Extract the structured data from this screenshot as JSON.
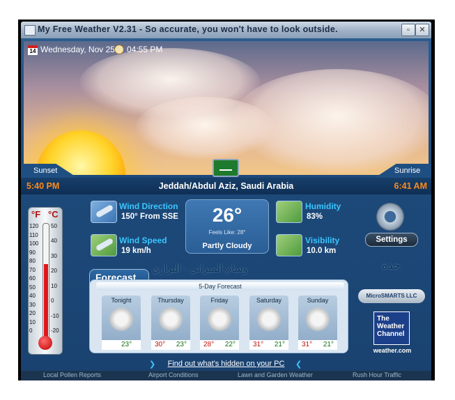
{
  "window": {
    "title": "My Free Weather V2.31 -  So accurate, you won't have to look outside.",
    "close_label": "✕"
  },
  "header": {
    "date": "Wednesday, Nov 25",
    "time": "04:55 PM",
    "calendar_day": "14"
  },
  "sun": {
    "sunset_label": "Sunset",
    "sunrise_label": "Sunrise",
    "sunset_time": "5:40 PM",
    "sunrise_time": "6:41 AM"
  },
  "location": "Jeddah/Abdul Aziz, Saudi Arabia",
  "thermometer": {
    "f_label": "°F",
    "c_label": "°C",
    "f_ticks": [
      "120",
      "110",
      "100",
      "90",
      "80",
      "70",
      "60",
      "50",
      "40",
      "30",
      "20",
      "10",
      "0"
    ],
    "c_ticks": [
      "50",
      "40",
      "30",
      "20",
      "10",
      "0",
      "-10",
      "-20"
    ]
  },
  "conditions": {
    "wind_direction_label": "Wind Direction",
    "wind_direction_value": "150° From SSE",
    "wind_speed_label": "Wind Speed",
    "wind_speed_value": "19 km/h",
    "humidity_label": "Humidity",
    "humidity_value": "83%",
    "visibility_label": "Visibility",
    "visibility_value": "10.0 km",
    "temperature": "26°",
    "feels_like": "Feels Like: 28°",
    "description": "Partly Cloudy"
  },
  "settings_label": "Settings",
  "arabic_text": "وسام الميزاني - البراري",
  "arabic_city": "جدة",
  "forecast": {
    "tab_label": "Forecast",
    "header": "5-Day Forecast",
    "days": [
      {
        "name": "Tonight",
        "hi": "",
        "lo": "23°"
      },
      {
        "name": "Thursday",
        "hi": "30°",
        "lo": "23°"
      },
      {
        "name": "Friday",
        "hi": "28°",
        "lo": "22°"
      },
      {
        "name": "Saturday",
        "hi": "31°",
        "lo": "21°"
      },
      {
        "name": "Sunday",
        "hi": "31°",
        "lo": "21°"
      }
    ]
  },
  "branding": {
    "microsmarts": "MicroSMARTS LLC",
    "twc_line1": "The",
    "twc_line2": "Weather",
    "twc_line3": "Channel",
    "twc_url": "weather.com"
  },
  "promo_link": "Find out what's hidden on your PC",
  "bottom_links": [
    "Local Pollen Reports",
    "Airport Conditions",
    "Lawn and Garden Weather",
    "Rush Hour Traffic"
  ],
  "colors": {
    "accent_label": "#39c6ff",
    "time_orange": "#ff8a1a",
    "high_temp": "#c01010",
    "low_temp": "#107010"
  }
}
